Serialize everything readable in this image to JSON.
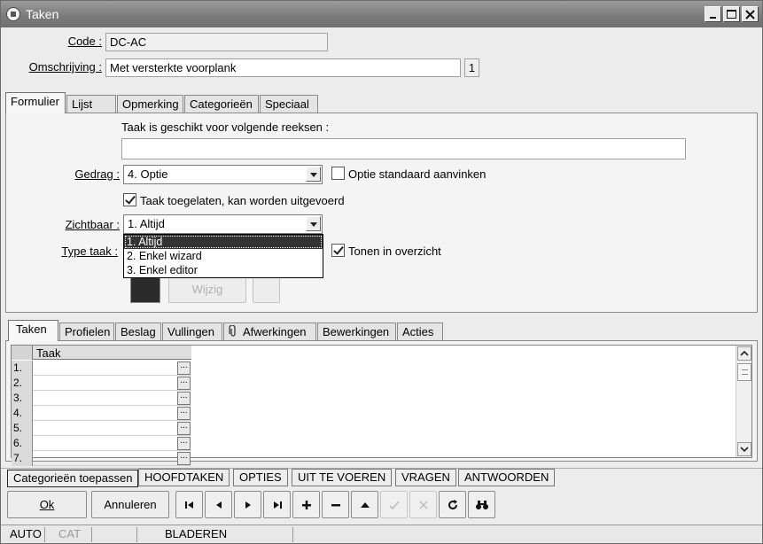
{
  "window": {
    "title": "Taken"
  },
  "header": {
    "code_label": "Code :",
    "code_value": "DC-AC",
    "omschrijving_label": "Omschrijving :",
    "omschrijving_value": "Met versterkte voorplank",
    "omschrijving_badge": "1"
  },
  "top_tabs": [
    {
      "label": "Formulier"
    },
    {
      "label": "Lijst"
    },
    {
      "label": "Opmerking"
    },
    {
      "label": "Categorieën"
    },
    {
      "label": "Speciaal"
    }
  ],
  "form": {
    "reeksen_label": "Taak is geschikt voor volgende reeksen :",
    "reeksen_value": "",
    "gedrag_label": "Gedrag :",
    "gedrag_value": "4.  Optie",
    "optie_standaard_label": "Optie standaard aanvinken",
    "optie_standaard_checked": false,
    "toegelaten_label": "Taak toegelaten, kan worden uitgevoerd",
    "toegelaten_checked": true,
    "zichtbaar_label": "Zichtbaar :",
    "zichtbaar_value": "1.  Altijd",
    "zichtbaar_options": [
      "1.  Altijd",
      "2.  Enkel wizard",
      "3.  Enkel editor"
    ],
    "type_taak_label": "Type taak :",
    "tonen_label": "Tonen in overzicht",
    "tonen_checked": true,
    "color_swatch": "#2b2b2b",
    "wijzig_label": "Wijzig"
  },
  "bottom_tabs": [
    {
      "label": "Taken"
    },
    {
      "label": "Profielen"
    },
    {
      "label": "Beslag"
    },
    {
      "label": "Vullingen"
    },
    {
      "label": "Afwerkingen",
      "icon": "paperclip-icon"
    },
    {
      "label": "Bewerkingen"
    },
    {
      "label": "Acties"
    }
  ],
  "grid": {
    "column_header": "Taak",
    "rows": [
      "1.",
      "2.",
      "3.",
      "4.",
      "5.",
      "6.",
      "7."
    ],
    "ellipsis": "..."
  },
  "category_buttons": [
    {
      "label": "Categorieën toepassen"
    },
    {
      "label": "HOOFDTAKEN"
    },
    {
      "label": "OPTIES"
    },
    {
      "label": "UIT TE VOEREN"
    },
    {
      "label": "VRAGEN"
    },
    {
      "label": "ANTWOORDEN"
    }
  ],
  "actions": {
    "ok_label": "Ok",
    "annuleren_label": "Annuleren"
  },
  "status_bar": [
    "AUTO",
    "CAT",
    "",
    "BLADEREN"
  ]
}
